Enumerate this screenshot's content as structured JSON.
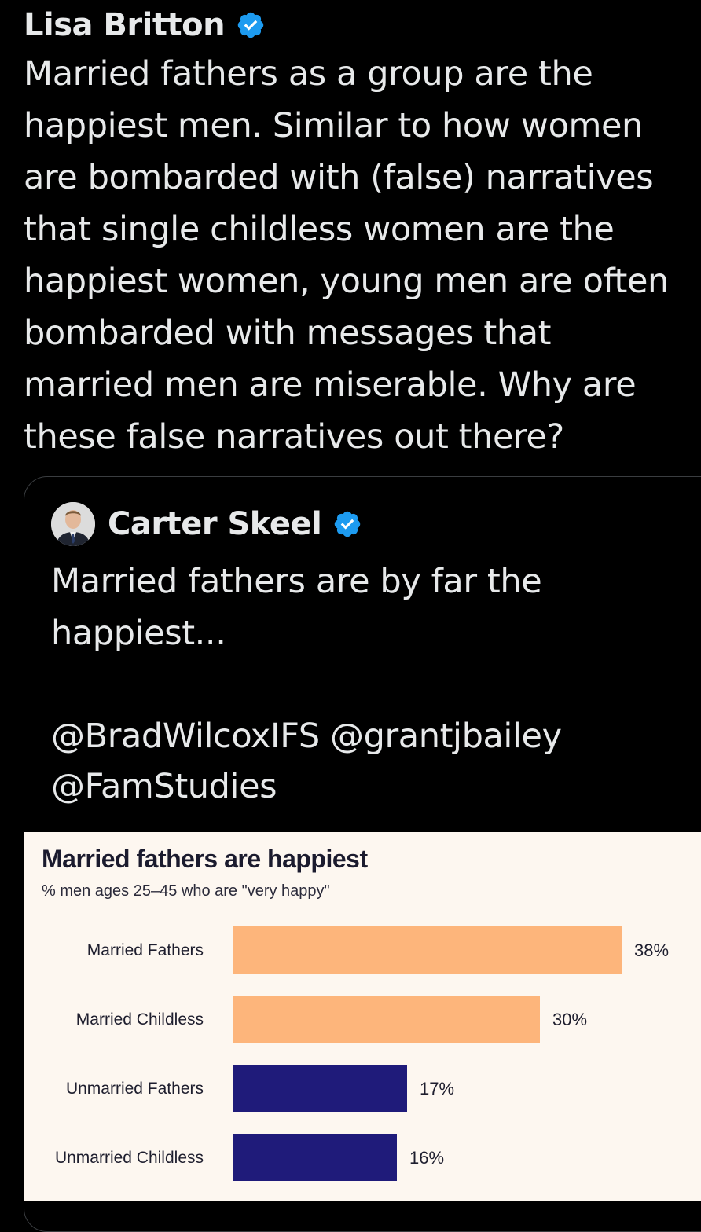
{
  "tweet": {
    "author_name": "Lisa Britton",
    "text": "Married fathers as a group are the\nhappiest men. Similar to how women\nare bombarded with (false) narratives\nthat single childless women are the\nhappiest women, young men are often\nbombarded with messages that\nmarried men are miserable. Why are\nthese false narratives out there?"
  },
  "quote": {
    "author_name": "Carter Skeel",
    "text": "Married fathers are by far the\nhappiest...",
    "mentions": [
      "@BradWilcoxIFS",
      "@grantjbailey",
      "@FamStudies"
    ]
  },
  "icons": {
    "verified": "verified-badge-icon",
    "avatar": "profile-photo"
  },
  "colors": {
    "verified_blue": "#1d9bf0",
    "married_bar": "#fdb57b",
    "unmarried_bar": "#1f1b7a",
    "chart_background": "#fdf7f0"
  },
  "chart_data": {
    "type": "bar",
    "orientation": "horizontal",
    "title": "Married fathers are happiest",
    "subtitle": "% men ages 25–45 who are \"very happy\"",
    "categories": [
      "Married Fathers",
      "Married Childless",
      "Unmarried Fathers",
      "Unmarried Childless"
    ],
    "values": [
      38,
      30,
      17,
      16
    ],
    "value_labels": [
      "38%",
      "30%",
      "17%",
      "16%"
    ],
    "bar_colors": [
      "#fdb57b",
      "#fdb57b",
      "#1f1b7a",
      "#1f1b7a"
    ],
    "xlim": [
      0,
      40
    ],
    "grid": false,
    "legend": "none"
  }
}
